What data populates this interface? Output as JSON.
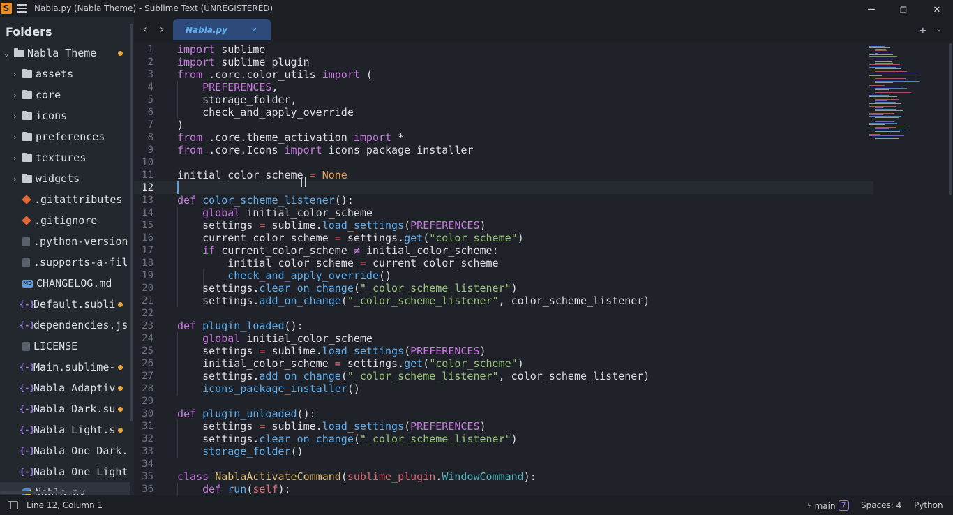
{
  "window": {
    "title": "Nabla.py (Nabla Theme) - Sublime Text (UNREGISTERED)",
    "app_icon": "S",
    "min_glyph": "—",
    "max_glyph": "❐",
    "close_glyph": "✕"
  },
  "sidebar": {
    "heading": "Folders",
    "root": "Nabla Theme",
    "folders": [
      "assets",
      "core",
      "icons",
      "preferences",
      "textures",
      "widgets"
    ],
    "files": [
      {
        "name": ".gitattributes",
        "icon": "git-icon",
        "dirty": false
      },
      {
        "name": ".gitignore",
        "icon": "git-icon",
        "dirty": false
      },
      {
        "name": ".python-version",
        "icon": "file-icon",
        "dirty": false
      },
      {
        "name": ".supports-a-fil",
        "icon": "file-icon",
        "dirty": false
      },
      {
        "name": "CHANGELOG.md",
        "icon": "markdown-icon",
        "dirty": false
      },
      {
        "name": "Default.subli",
        "icon": "json-icon",
        "dirty": true
      },
      {
        "name": "dependencies.js",
        "icon": "json-icon",
        "dirty": false
      },
      {
        "name": "LICENSE",
        "icon": "file-icon",
        "dirty": false
      },
      {
        "name": "Main.sublime-",
        "icon": "json-icon",
        "dirty": true
      },
      {
        "name": "Nabla Adaptiv",
        "icon": "json-icon",
        "dirty": true
      },
      {
        "name": "Nabla Dark.su",
        "icon": "json-icon",
        "dirty": true
      },
      {
        "name": "Nabla Light.s",
        "icon": "json-icon",
        "dirty": true
      },
      {
        "name": "Nabla One Dark.",
        "icon": "json-icon",
        "dirty": false
      },
      {
        "name": "Nabla One Light",
        "icon": "json-icon",
        "dirty": false
      },
      {
        "name": "Nabla.py",
        "icon": "python-icon",
        "dirty": false
      }
    ]
  },
  "tabs": {
    "back_glyph": "‹",
    "forward_glyph": "›",
    "active_label": "Nabla.py",
    "close_glyph": "✕",
    "new_tab_glyph": "+",
    "tab_list_glyph": "⌄"
  },
  "editor": {
    "current_line": 12,
    "line_numbers": [
      "1",
      "2",
      "3",
      "4",
      "5",
      "6",
      "7",
      "8",
      "9",
      "10",
      "11",
      "12",
      "13",
      "14",
      "15",
      "16",
      "17",
      "18",
      "19",
      "20",
      "21",
      "22",
      "23",
      "24",
      "25",
      "26",
      "27",
      "28",
      "29",
      "30",
      "31",
      "32",
      "33",
      "34",
      "35",
      "36"
    ]
  },
  "status": {
    "cursor": "Line 12, Column 1",
    "branch": "main",
    "branch_count": "7",
    "branch_glyph": "⑂",
    "spaces": "Spaces: 4",
    "syntax": "Python"
  }
}
